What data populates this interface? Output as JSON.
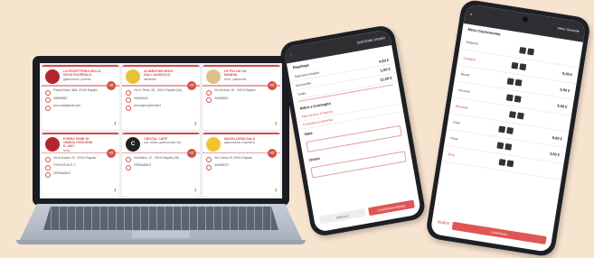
{
  "cards": [
    {
      "title": "LA PIZZETTERIA DELLA\nNOVA PIZZERIA D.",
      "subtitle": "gastronomia, pizzeria",
      "logo_color": "#b3262e",
      "logo_text": "",
      "rows": [
        "Piazza Roma 38/A, 20010 Rapallo",
        "348589857",
        "pt.nuova@gmail.com"
      ]
    },
    {
      "title": "ALIMENTARI BONI\nDALL'ANGELICO",
      "subtitle": "alimentari",
      "logo_color": "#e8c23a",
      "logo_text": "",
      "rows": [
        "Via S. Pietro, 28 - 20010 Rapallo (MI)",
        "342665141",
        "ab.angelico@email.it"
      ]
    },
    {
      "title": "LE FOLLIE DA\nMANHIA",
      "subtitle": "forno, pasticceria",
      "logo_color": "#d8c48a",
      "logo_text": "",
      "rows": [
        "Via Venezia, 18 - 20010 Rapallo",
        "342888611"
      ]
    },
    {
      "title": "FORNO PANE DI\nOMEGA PUGLIESE\nE. 1967",
      "subtitle": "forno",
      "logo_color": "#b3262e",
      "logo_text": "",
      "rows": [
        "Via di Anzani, 20 - 20010 Rapallo",
        "FORNOSI ALP. 3",
        "ORDINABILE"
      ]
    },
    {
      "title": "CRISTAL CAFE",
      "subtitle": "pub, drinks, gastronomia, bar",
      "logo_color": "#222222",
      "logo_text": "C",
      "rows": [
        "Via Milano, 12 - 20010 Rapallo (MI)",
        "ORDINABILE"
      ]
    },
    {
      "title": "MACELLERIA SALA",
      "subtitle": "gastronomia, macelleria",
      "logo_color": "#f0c430",
      "logo_text": "",
      "rows": [
        "Via Chiesa 29, 20010 Rapallo",
        "342888722"
      ]
    }
  ],
  "phone1": {
    "header": "GESTIONE ORDINI",
    "section1": "Riepilogo",
    "rows": [
      {
        "label": "Salumeria Magolo",
        "value": "4,00 €"
      },
      {
        "label": "Mozzarella",
        "value": "1,00 €"
      },
      {
        "label": "Totale",
        "value": "11,50 €"
      }
    ],
    "section2": "Ritiro e Consegna",
    "rows2": [
      "Ritiro presso il negozio",
      "Consegna a domicilio"
    ],
    "section3": "Note",
    "section4": "Orario",
    "btn_left": "ANNULLA",
    "btn_right": "CONFERMA ORDINE"
  },
  "phone2": {
    "header": "Menu Generale",
    "section1": "Menu Gastronomia",
    "items": [
      {
        "label": "Antipasti",
        "value": ""
      },
      {
        "label": "Lasagne",
        "value": "0,00 €"
      },
      {
        "label": "Risotti",
        "value": "5,00 €"
      },
      {
        "label": "Secondi",
        "value": "6,50 €"
      },
      {
        "label": "Bevande",
        "value": ""
      },
      {
        "label": "Dolci",
        "value": "8,00 €"
      },
      {
        "label": "Pane",
        "value": "3,00 €"
      },
      {
        "label": "Birre",
        "value": ""
      }
    ],
    "total": "11,50 €",
    "btn": "CONFERMA"
  }
}
